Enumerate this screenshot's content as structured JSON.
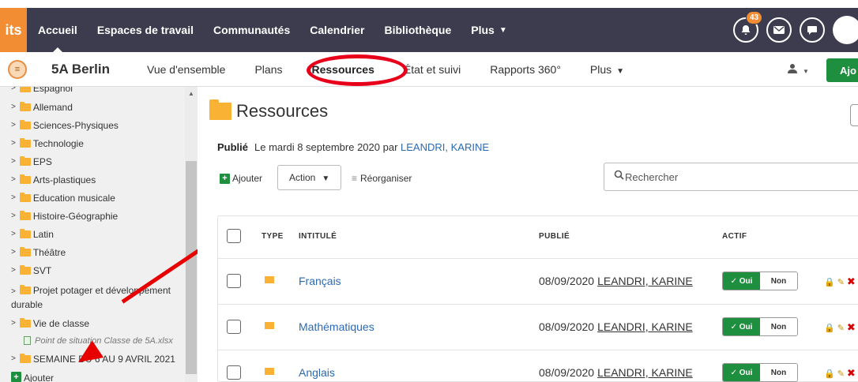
{
  "topbar": {
    "logo": "its",
    "nav": [
      "Accueil",
      "Espaces de travail",
      "Communautés",
      "Calendrier",
      "Bibliothèque",
      "Plus"
    ],
    "notif_count": "43",
    "icons": [
      "bell-icon",
      "mail-icon",
      "chat-icon",
      "avatar"
    ]
  },
  "subbar": {
    "group_title": "5A Berlin",
    "tabs": [
      "Vue d'ensemble",
      "Plans",
      "Ressources",
      "État et suivi",
      "Rapports 360°",
      "Plus"
    ],
    "active_tab": "Ressources",
    "add_label": "Ajo"
  },
  "sidebar": {
    "items": [
      {
        "label": "Espagnol"
      },
      {
        "label": "Allemand"
      },
      {
        "label": "Sciences-Physiques"
      },
      {
        "label": "Technologie"
      },
      {
        "label": "EPS"
      },
      {
        "label": "Arts-plastiques"
      },
      {
        "label": "Education musicale"
      },
      {
        "label": "Histoire-Géographie"
      },
      {
        "label": "Latin"
      },
      {
        "label": "Théâtre"
      },
      {
        "label": "SVT"
      },
      {
        "label": "Projet potager et développement durable"
      },
      {
        "label": "Vie de classe"
      },
      {
        "label": "Point de situation Classe de 5A.xlsx"
      },
      {
        "label": "SEMAINE DU 6 AU 9 AVRIL 2021"
      },
      {
        "label": "Ajouter"
      }
    ]
  },
  "main": {
    "title": "Ressources",
    "published_label": "Publié",
    "published_text": "Le mardi 8 septembre 2020 par",
    "published_author": "LEANDRI, KARINE",
    "ajouter": "Ajouter",
    "action": "Action",
    "reorganiser": "Réorganiser",
    "search_placeholder": "Rechercher",
    "columns": [
      "TYPE",
      "INTITULÉ",
      "PUBLIÉ",
      "ACTIF"
    ],
    "rows": [
      {
        "name": "Français",
        "date": "08/09/2020",
        "author": "LEANDRI, KARINE",
        "on": "✓ Oui",
        "off": "Non"
      },
      {
        "name": "Mathématiques",
        "date": "08/09/2020",
        "author": "LEANDRI, KARINE",
        "on": "✓ Oui",
        "off": "Non"
      },
      {
        "name": "Anglais",
        "date": "08/09/2020",
        "author": "LEANDRI, KARINE",
        "on": "✓ Oui",
        "off": "Non"
      }
    ]
  },
  "colors": {
    "topbar": "#3d3c4e",
    "accent": "#f38d34",
    "green": "#1e8f3e",
    "link": "#2a6ab3",
    "highlight": "#e8001b"
  }
}
